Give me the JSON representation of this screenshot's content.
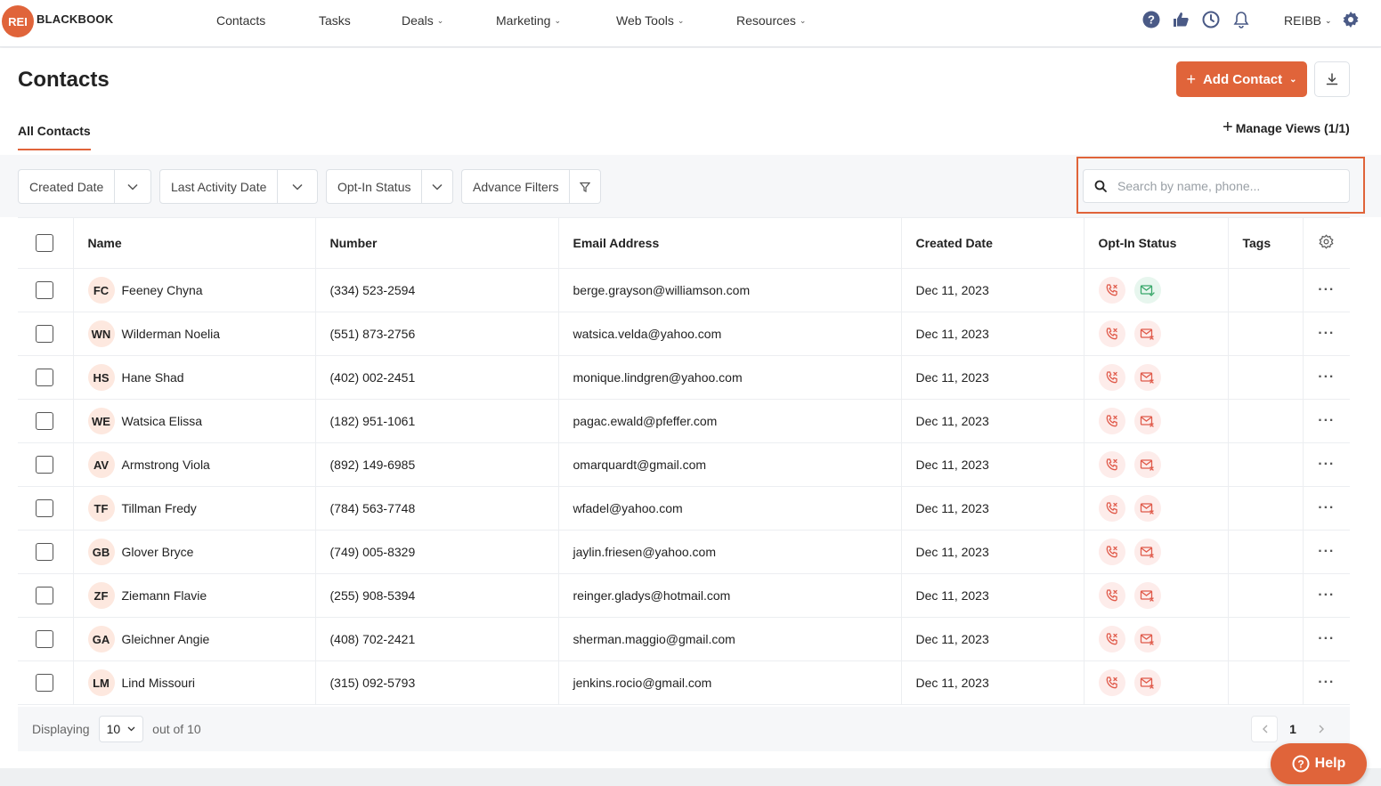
{
  "brand": {
    "badge": "REI",
    "name": "BLACKBOOK"
  },
  "nav": [
    {
      "label": "Contacts",
      "dropdown": false
    },
    {
      "label": "Tasks",
      "dropdown": false
    },
    {
      "label": "Deals",
      "dropdown": true
    },
    {
      "label": "Marketing",
      "dropdown": true
    },
    {
      "label": "Web Tools",
      "dropdown": true
    },
    {
      "label": "Resources",
      "dropdown": true
    }
  ],
  "user": {
    "label": "REIBB"
  },
  "page": {
    "title": "Contacts",
    "add_label": "Add Contact",
    "tab": "All Contacts",
    "manage_views": "Manage Views (1/1)"
  },
  "filters": {
    "created_date": "Created Date",
    "last_activity": "Last Activity Date",
    "opt_in": "Opt-In Status",
    "advance": "Advance Filters"
  },
  "search": {
    "placeholder": "Search by name, phone..."
  },
  "table": {
    "headers": {
      "name": "Name",
      "number": "Number",
      "email": "Email Address",
      "created": "Created Date",
      "optin": "Opt-In Status",
      "tags": "Tags"
    },
    "rows": [
      {
        "initials": "FC",
        "name": "Feeney Chyna",
        "number": "(334) 523-2594",
        "email": "berge.grayson@williamson.com",
        "created": "Dec 11, 2023",
        "email_opt": true
      },
      {
        "initials": "WN",
        "name": "Wilderman Noelia",
        "number": "(551) 873-2756",
        "email": "watsica.velda@yahoo.com",
        "created": "Dec 11, 2023",
        "email_opt": false
      },
      {
        "initials": "HS",
        "name": "Hane Shad",
        "number": "(402) 002-2451",
        "email": "monique.lindgren@yahoo.com",
        "created": "Dec 11, 2023",
        "email_opt": false
      },
      {
        "initials": "WE",
        "name": "Watsica Elissa",
        "number": "(182) 951-1061",
        "email": "pagac.ewald@pfeffer.com",
        "created": "Dec 11, 2023",
        "email_opt": false
      },
      {
        "initials": "AV",
        "name": "Armstrong Viola",
        "number": "(892) 149-6985",
        "email": "omarquardt@gmail.com",
        "created": "Dec 11, 2023",
        "email_opt": false
      },
      {
        "initials": "TF",
        "name": "Tillman Fredy",
        "number": "(784) 563-7748",
        "email": "wfadel@yahoo.com",
        "created": "Dec 11, 2023",
        "email_opt": false
      },
      {
        "initials": "GB",
        "name": "Glover Bryce",
        "number": "(749) 005-8329",
        "email": "jaylin.friesen@yahoo.com",
        "created": "Dec 11, 2023",
        "email_opt": false
      },
      {
        "initials": "ZF",
        "name": "Ziemann Flavie",
        "number": "(255) 908-5394",
        "email": "reinger.gladys@hotmail.com",
        "created": "Dec 11, 2023",
        "email_opt": false
      },
      {
        "initials": "GA",
        "name": "Gleichner Angie",
        "number": "(408) 702-2421",
        "email": "sherman.maggio@gmail.com",
        "created": "Dec 11, 2023",
        "email_opt": false
      },
      {
        "initials": "LM",
        "name": "Lind Missouri",
        "number": "(315) 092-5793",
        "email": "jenkins.rocio@gmail.com",
        "created": "Dec 11, 2023",
        "email_opt": false
      }
    ]
  },
  "pagination": {
    "displaying": "Displaying",
    "per_page": "10",
    "out_of": "out of 10",
    "current": "1"
  },
  "help": {
    "label": "Help"
  },
  "colors": {
    "accent": "#e0643a",
    "opt_out": "#e0643a",
    "opt_in": "#3aa86b"
  }
}
